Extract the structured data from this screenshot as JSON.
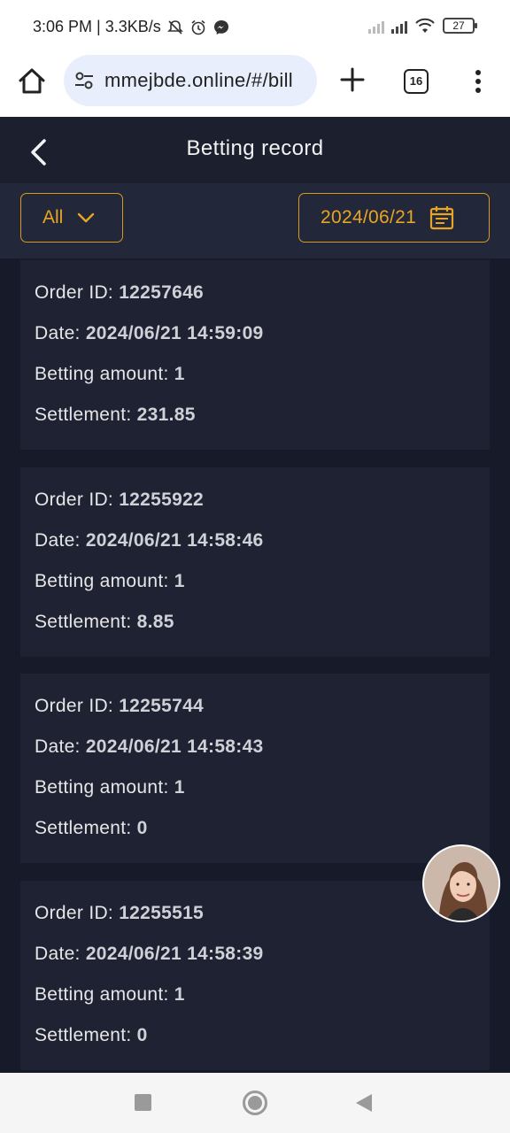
{
  "status_bar": {
    "time_speed": "3:06 PM | 3.3KB/s",
    "battery": "27",
    "icons": [
      "mute-icon",
      "alarm-icon",
      "messenger-icon",
      "signal-icon",
      "wifi-icon",
      "battery-icon"
    ]
  },
  "browser": {
    "url": "mmejbde.online/#/bill",
    "tab_count": "16"
  },
  "header": {
    "title": "Betting record"
  },
  "filters": {
    "type_selected": "All",
    "date": "2024/06/21"
  },
  "labels": {
    "order_id": "Order ID: ",
    "date": "Date: ",
    "amount": "Betting amount: ",
    "settlement": "Settlement: "
  },
  "records": [
    {
      "order_id": "12257646",
      "date": "2024/06/21 14:59:09",
      "amount": "1",
      "settlement": "231.85"
    },
    {
      "order_id": "12255922",
      "date": "2024/06/21 14:58:46",
      "amount": "1",
      "settlement": "8.85"
    },
    {
      "order_id": "12255744",
      "date": "2024/06/21 14:58:43",
      "amount": "1",
      "settlement": "0"
    },
    {
      "order_id": "12255515",
      "date": "2024/06/21 14:58:39",
      "amount": "1",
      "settlement": "0"
    }
  ],
  "colors": {
    "accent": "#e9a424",
    "background": "#171b29",
    "card": "#1e2233"
  }
}
